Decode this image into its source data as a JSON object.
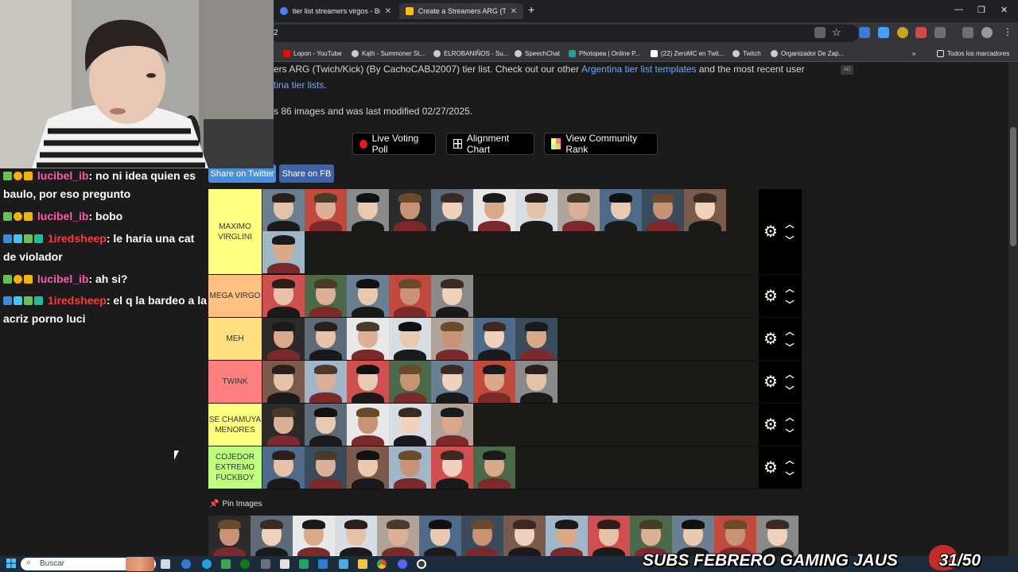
{
  "browser": {
    "tabs": [
      {
        "label": "tier list streamers virgos - Busca",
        "active": false
      },
      {
        "label": "Create a Streamers ARG (Twitch",
        "active": true
      }
    ],
    "new_tab": "+",
    "window": {
      "minimize": "—",
      "restore": "❐",
      "close": "✕"
    },
    "url": "2",
    "bookmarks": [
      {
        "label": "Lopon - YouTube",
        "color": "#ff0000"
      },
      {
        "label": "Kąth - Summoner St...",
        "color": "#cccccc"
      },
      {
        "label": "ELROBANIÑOS - Su...",
        "color": "#cccccc"
      },
      {
        "label": "SpeechChat",
        "color": "#cccccc"
      },
      {
        "label": "Photopea | Online P...",
        "color": "#18a497"
      },
      {
        "label": "(22) ZeroMC en Twit...",
        "color": "#ffffff"
      },
      {
        "label": "Twitch",
        "color": "#cccccc"
      },
      {
        "label": "Organizador De Zap...",
        "color": "#cccccc"
      }
    ],
    "more_bookmarks": "»",
    "all_bookmarks": "Todos los marcadores"
  },
  "page": {
    "intro_1": "ers ARG (Twich/Kick) (By CachoCABJ2007) tier list. Check out our other ",
    "intro_link_1": "Argentina tier list templates",
    "intro_2": " and the most recent user",
    "intro_link_2": "tina tier lists",
    "intro_period": ".",
    "intro_3": "s 86 images and was last modified 02/27/2025.",
    "ad": "AD",
    "buttons": {
      "live_voting": "Live Voting Poll",
      "alignment": "Alignment Chart",
      "community": "View Community Rank"
    },
    "share_twitter": "Share on Twitter",
    "share_fb": "Share on FB",
    "pin_images": "Pin Images"
  },
  "tiers": [
    {
      "label": "MAXIMO VIRGLINI",
      "color": "#ffff80",
      "count": 12
    },
    {
      "label": "MEGA VIRGO",
      "color": "#ffbf7f",
      "count": 5
    },
    {
      "label": "MEH",
      "color": "#ffdf7f",
      "count": 7
    },
    {
      "label": "TWINK",
      "color": "#ff7f7f",
      "count": 7
    },
    {
      "label": "SE CHAMUYA MENORES",
      "color": "#ffff7f",
      "count": 5
    },
    {
      "label": "COJEDOR EXTREMO FUCKBOY",
      "color": "#bfff7f",
      "count": 6
    }
  ],
  "pool_count": 14,
  "chat": [
    {
      "user": "lucibel_ib",
      "message": ": no ni idea quien es baulo, por eso pregunto",
      "style": "a"
    },
    {
      "user": "lucibel_ib",
      "message": ": bobo",
      "style": "a"
    },
    {
      "user": "1iredsheep",
      "message": ": le haria una cat de violador",
      "style": "b"
    },
    {
      "user": "lucibel_ib",
      "message": ": ah si?",
      "style": "a"
    },
    {
      "user": "1iredsheep",
      "message": ": el q la bardeo a la acriz porno luci",
      "style": "b"
    }
  ],
  "taskbar": {
    "search_placeholder": "Buscar",
    "banner": "SUBS FEBRERO GAMING JAUS",
    "counter": "31/50"
  }
}
